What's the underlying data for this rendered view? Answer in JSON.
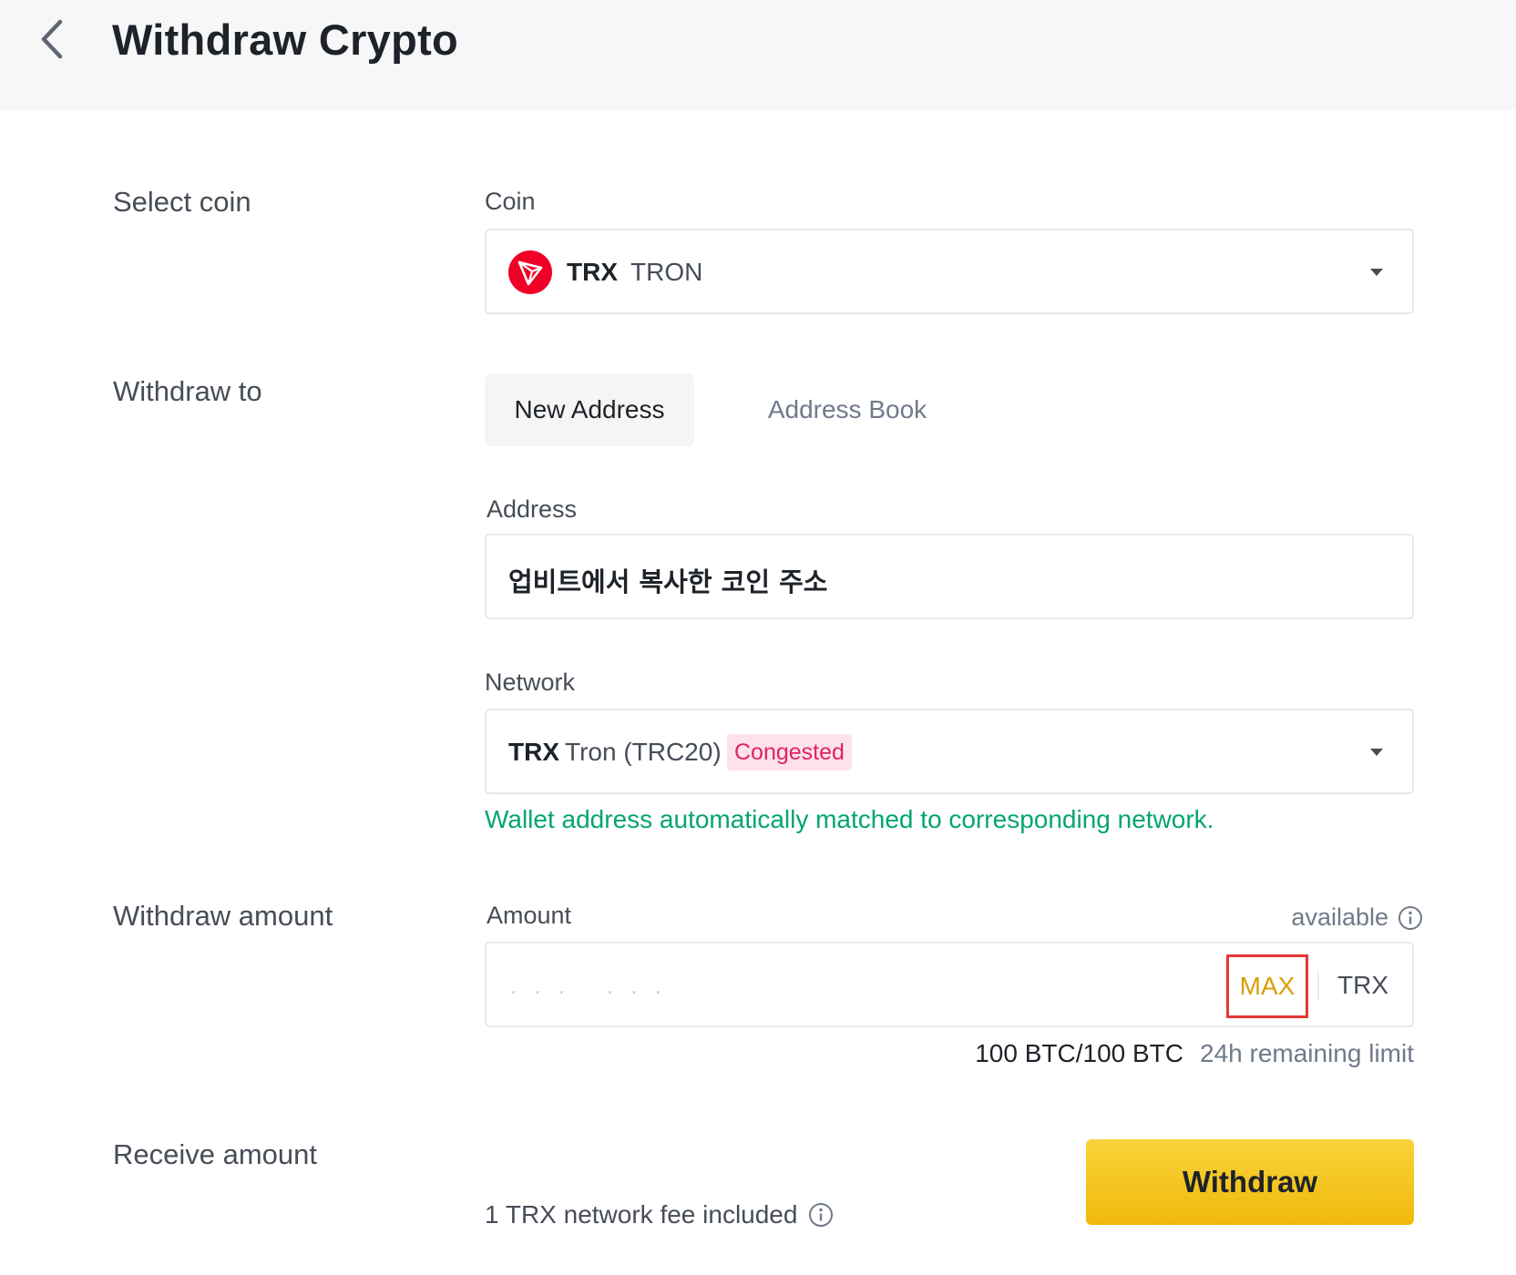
{
  "header": {
    "title": "Withdraw Crypto",
    "back_icon": "chevron-left-icon"
  },
  "select_coin": {
    "section_label": "Select coin",
    "field_label": "Coin",
    "symbol": "TRX",
    "name": "TRON",
    "logo_icon": "tron-logo-icon",
    "logo_color": "#ef0027"
  },
  "withdraw_to": {
    "section_label": "Withdraw to",
    "tabs": [
      {
        "label": "New Address",
        "active": true
      },
      {
        "label": "Address Book",
        "active": false
      }
    ]
  },
  "address": {
    "field_label": "Address",
    "value": "업비트에서 복사한 코인 주소"
  },
  "network": {
    "field_label": "Network",
    "symbol": "TRX",
    "name": "Tron (TRC20)",
    "badge": "Congested",
    "hint": "Wallet address automatically matched to corresponding network."
  },
  "amount": {
    "section_label": "Withdraw amount",
    "field_label": "Amount",
    "available_label": "available",
    "placeholder": ". . .   . . .",
    "max_label": "MAX",
    "unit": "TRX",
    "limit_value": "100 BTC/100 BTC",
    "limit_label": "24h remaining limit"
  },
  "receive": {
    "section_label": "Receive amount",
    "fee_text": "1 TRX network fee included",
    "withdraw_label": "Withdraw"
  },
  "colors": {
    "accent": "#f0b90b",
    "success": "#03a66d",
    "danger": "#e0245e",
    "highlight_box": "#e53935"
  }
}
